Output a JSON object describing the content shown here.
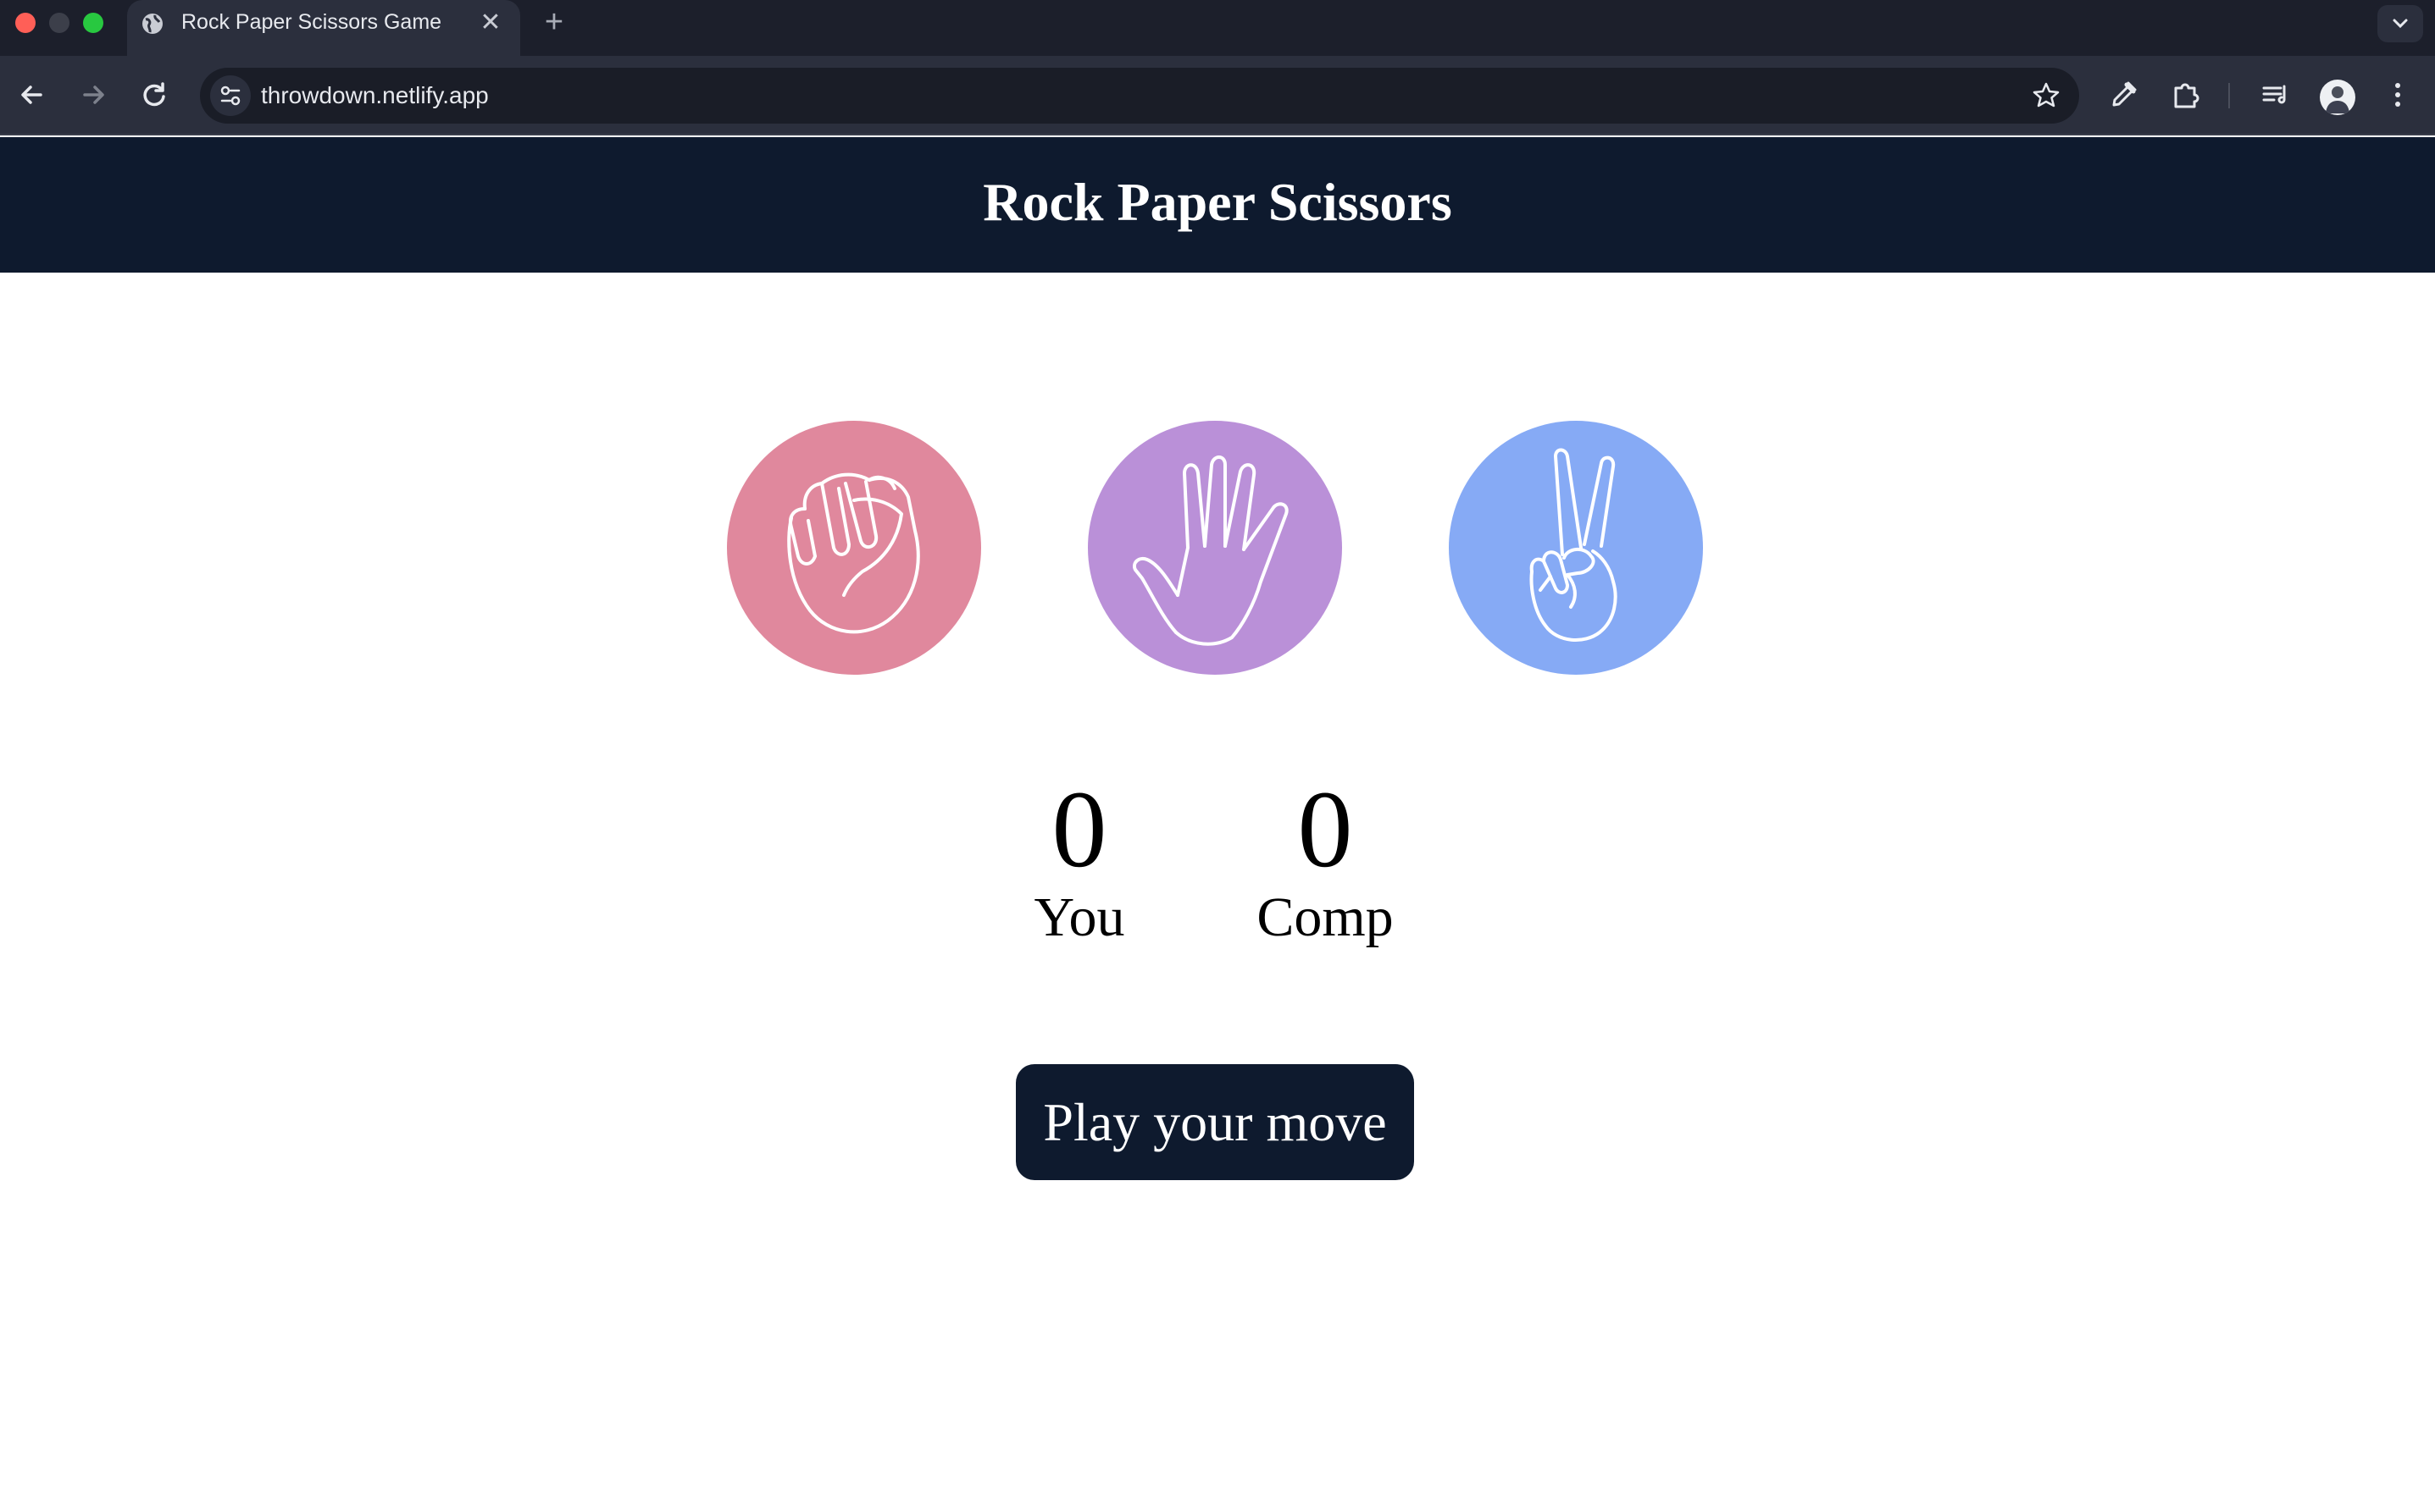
{
  "browser": {
    "tab_title": "Rock Paper Scissors Game",
    "tab_close": "✕",
    "new_tab": "+",
    "url": "throwdown.netlify.app"
  },
  "app": {
    "title": "Rock Paper Scissors",
    "choices": [
      {
        "name": "rock",
        "color": "#e0889d",
        "icon": "fist-icon"
      },
      {
        "name": "paper",
        "color": "#ba90d8",
        "icon": "open-hand-icon"
      },
      {
        "name": "scissors",
        "color": "#86aaf5",
        "icon": "peace-sign-icon"
      }
    ],
    "scores": {
      "user": {
        "value": "0",
        "label": "You"
      },
      "comp": {
        "value": "0",
        "label": "Comp"
      }
    },
    "play_button": "Play your move",
    "colors": {
      "header_bg": "#0e1a2e",
      "button_bg": "#0e1a2e"
    }
  }
}
